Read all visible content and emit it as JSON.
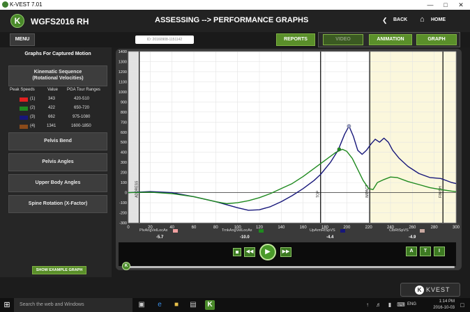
{
  "window": {
    "title": "K-VEST 7.01",
    "minimize": "—",
    "maximize": "□",
    "close": "✕"
  },
  "header": {
    "logo_letter": "K",
    "subject": "WGFS2016  RH",
    "page_title": "ASSESSING --> PERFORMANCE GRAPHS",
    "back_label": "BACK",
    "home_label": "HOME"
  },
  "menubar": {
    "menu_label": "MENU",
    "session_id": "ID: 20160908-1151142",
    "reports_label": "REPORTS",
    "tabs": [
      "VIDEO",
      "ANIMATION",
      "GRAPH"
    ]
  },
  "sidebar": {
    "section_title": "Graphs For Captured Motion",
    "kinematic_title": "Kinematic Sequence",
    "kinematic_sub": "(Rotational Velocities)",
    "table_headers": [
      "Peak Speeds",
      "Value",
      "PGA Tour Ranges"
    ],
    "rows": [
      {
        "color": "#e02020",
        "label": "(1)",
        "value": "343",
        "range": "420-510"
      },
      {
        "color": "#1f8a1f",
        "label": "(2)",
        "value": "422",
        "range": "650-720"
      },
      {
        "color": "#17177a",
        "label": "(3)",
        "value": "662",
        "range": "975-1080"
      },
      {
        "color": "#8a4a1a",
        "label": "(4)",
        "value": "1341",
        "range": "1600-1850"
      }
    ],
    "buttons": [
      "Pelvis Bend",
      "Pelvis Angles",
      "Upper Body Angles",
      "Spine Rotation (X-Factor)"
    ],
    "example_label": "SHOW EXAMPLE GRAPH"
  },
  "legend": [
    {
      "name": "PlvAngVelLocAx",
      "color": "#f0a0a0",
      "value": "-5.7"
    },
    {
      "name": "TrnkAngVelLocAx",
      "color": "#1f8a1f",
      "value": "-10.0"
    },
    {
      "name": "UpArmRtSpVS",
      "color": "#17177a",
      "value": "-4.4"
    },
    {
      "name": "ClbRtSpVS",
      "color": "#c8a8a0",
      "value": "-4.9"
    }
  ],
  "playback": {
    "marker_buttons": [
      "A",
      "T",
      "I"
    ],
    "slider_knob": "K"
  },
  "branding": {
    "text": "KVEST"
  },
  "taskbar": {
    "search_placeholder": "Search the web and Windows",
    "time": "1:14 PM",
    "date": "2016-10-03",
    "lang": "ENG"
  },
  "chart_data": {
    "type": "line",
    "xlim": [
      0,
      300
    ],
    "ylim": [
      -300,
      1400
    ],
    "x_ticks": [
      0,
      20,
      40,
      60,
      80,
      100,
      120,
      140,
      160,
      180,
      200,
      220,
      240,
      260,
      280,
      300
    ],
    "y_ticks": [
      -300,
      -200,
      -100,
      0,
      100,
      200,
      300,
      400,
      500,
      600,
      700,
      800,
      900,
      1000,
      1100,
      1200,
      1300,
      1400
    ],
    "grid": true,
    "events": [
      {
        "name": "ADDRESS",
        "x": 10
      },
      {
        "name": "TOP",
        "x": 176
      },
      {
        "name": "IMPACT",
        "x": 221
      },
      {
        "name": "FINISH",
        "x": 288
      }
    ],
    "shaded_regions": [
      [
        0,
        10
      ],
      [
        221,
        300
      ]
    ],
    "series": [
      {
        "color": "#17177a",
        "points": [
          [
            0,
            0
          ],
          [
            20,
            10
          ],
          [
            40,
            0
          ],
          [
            60,
            -40
          ],
          [
            80,
            -90
          ],
          [
            100,
            -150
          ],
          [
            110,
            -175
          ],
          [
            120,
            -170
          ],
          [
            130,
            -140
          ],
          [
            140,
            -90
          ],
          [
            150,
            -30
          ],
          [
            160,
            40
          ],
          [
            170,
            120
          ],
          [
            176,
            180
          ],
          [
            185,
            300
          ],
          [
            192,
            420
          ],
          [
            198,
            580
          ],
          [
            202,
            660
          ],
          [
            206,
            560
          ],
          [
            210,
            420
          ],
          [
            214,
            380
          ],
          [
            218,
            420
          ],
          [
            222,
            480
          ],
          [
            226,
            530
          ],
          [
            230,
            500
          ],
          [
            234,
            540
          ],
          [
            238,
            500
          ],
          [
            242,
            420
          ],
          [
            248,
            340
          ],
          [
            256,
            260
          ],
          [
            266,
            190
          ],
          [
            276,
            150
          ],
          [
            286,
            140
          ],
          [
            296,
            100
          ],
          [
            300,
            90
          ]
        ]
      },
      {
        "color": "#1f8a1f",
        "points": [
          [
            0,
            0
          ],
          [
            20,
            5
          ],
          [
            40,
            -10
          ],
          [
            60,
            -40
          ],
          [
            80,
            -90
          ],
          [
            90,
            -110
          ],
          [
            100,
            -100
          ],
          [
            110,
            -80
          ],
          [
            120,
            -50
          ],
          [
            130,
            -10
          ],
          [
            140,
            40
          ],
          [
            150,
            90
          ],
          [
            160,
            160
          ],
          [
            170,
            240
          ],
          [
            180,
            320
          ],
          [
            190,
            400
          ],
          [
            196,
            430
          ],
          [
            200,
            410
          ],
          [
            205,
            340
          ],
          [
            210,
            230
          ],
          [
            215,
            120
          ],
          [
            220,
            40
          ],
          [
            224,
            30
          ],
          [
            228,
            100
          ],
          [
            234,
            130
          ],
          [
            240,
            155
          ],
          [
            246,
            150
          ],
          [
            256,
            110
          ],
          [
            266,
            80
          ],
          [
            276,
            50
          ],
          [
            286,
            30
          ],
          [
            296,
            15
          ],
          [
            300,
            10
          ]
        ]
      }
    ],
    "markers": [
      {
        "x": 202,
        "y": 660,
        "color": "#9aa0c8"
      },
      {
        "x": 193,
        "y": 430,
        "color": "#1f8a1f"
      }
    ]
  }
}
